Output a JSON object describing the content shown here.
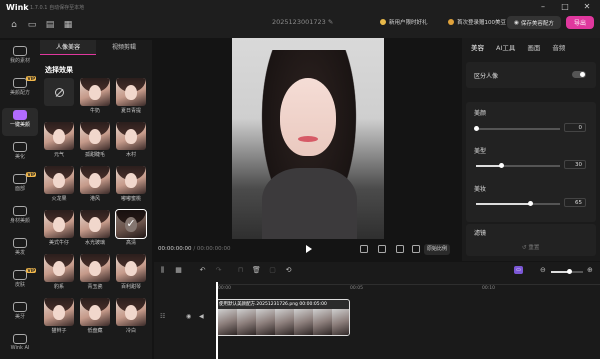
{
  "app": {
    "name": "Wink",
    "version": "1.7.0.1",
    "autosave": "自动保存至本地"
  },
  "project": {
    "name": "2025123001723"
  },
  "header": {
    "promo_new_user": "新用户限时好礼",
    "promo_login": "首次登录赠100美豆",
    "save_label": "保存美容配方",
    "export_label": "导出"
  },
  "rail": [
    {
      "label": "我的素材",
      "vip": false
    },
    {
      "label": "美颜配方",
      "vip": true
    },
    {
      "label": "一键美颜",
      "vip": false,
      "active": true
    },
    {
      "label": "美化",
      "vip": false
    },
    {
      "label": "面部",
      "vip": true
    },
    {
      "label": "身材美颜",
      "vip": false
    },
    {
      "label": "美发",
      "vip": false
    },
    {
      "label": "皮肤",
      "vip": true
    },
    {
      "label": "美牙",
      "vip": false
    },
    {
      "label": "Wink AI",
      "vip": false
    }
  ],
  "effects": {
    "tabs": [
      "人像美容",
      "视频剪辑"
    ],
    "section_title": "选择效果",
    "items": [
      {
        "label": "",
        "none": true
      },
      {
        "label": "牛奶"
      },
      {
        "label": "夏日青提"
      },
      {
        "label": "元气"
      },
      {
        "label": "孤甜睫毛"
      },
      {
        "label": "木村"
      },
      {
        "label": "火龙果"
      },
      {
        "label": "港风"
      },
      {
        "label": "嘟嘟蜜桃"
      },
      {
        "label": "美式牛仔"
      },
      {
        "label": "水光玻璃"
      },
      {
        "label": "高清",
        "selected": true
      },
      {
        "label": "豹系"
      },
      {
        "label": "青玉瓷"
      },
      {
        "label": "百利甜琴"
      },
      {
        "label": "猫辫子"
      },
      {
        "label": "低盘藏"
      },
      {
        "label": "冷白"
      }
    ]
  },
  "preview": {
    "time_current": "00:00:00:00",
    "time_total": "00:00:00:00",
    "ratio_label": "原始比例"
  },
  "right_panel": {
    "tabs": [
      "美容",
      "AI工具",
      "画面",
      "音频"
    ],
    "distinguish_label": "区分人像",
    "distinguish_on": true,
    "sliders": [
      {
        "label": "美颜",
        "value": 0
      },
      {
        "label": "美型",
        "value": 30
      },
      {
        "label": "美妆",
        "value": 65
      }
    ],
    "filter_label": "滤镜",
    "reset_label": "重置"
  },
  "timeline": {
    "ticks": [
      "00:00",
      "00:05",
      "00:10"
    ],
    "clip_caption": "使用默认美颜配方.20251231726.png    00:00:05:00"
  }
}
